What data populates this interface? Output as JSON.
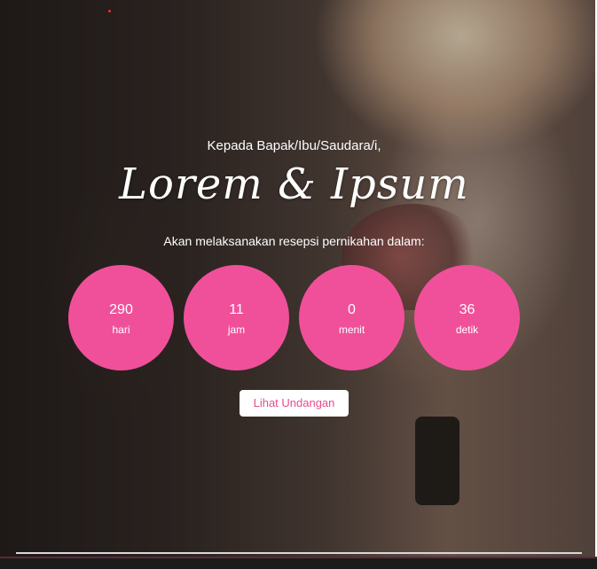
{
  "hero": {
    "greeting": "Kepada Bapak/Ibu/Saudara/i,",
    "couple_names": "Lorem & Ipsum",
    "subtitle": "Akan melaksanakan resepsi pernikahan dalam:"
  },
  "countdown": [
    {
      "value": "290",
      "unit": "hari"
    },
    {
      "value": "11",
      "unit": "jam"
    },
    {
      "value": "0",
      "unit": "menit"
    },
    {
      "value": "36",
      "unit": "detik"
    }
  ],
  "cta": {
    "label": "Lihat Undangan"
  },
  "colors": {
    "accent": "#f0509a",
    "button_text": "#e74c8c",
    "text": "#ffffff"
  }
}
